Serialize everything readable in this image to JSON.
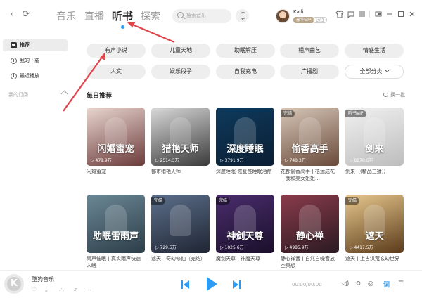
{
  "nav": {
    "back_glyph": "‹",
    "refresh_glyph": "⟳"
  },
  "main_tabs": [
    {
      "label": "音乐"
    },
    {
      "label": "直播"
    },
    {
      "label": "听书"
    },
    {
      "label": "探索"
    }
  ],
  "search": {
    "placeholder": "搜索音乐"
  },
  "user": {
    "name": "Kaili",
    "vip": "豪华VIP",
    "level": "LV.3"
  },
  "sidebar": {
    "items": [
      {
        "label": "推荐"
      },
      {
        "label": "我的下载"
      },
      {
        "label": "最近播放"
      }
    ],
    "section_label": "我的订阅"
  },
  "categories": [
    {
      "label": "有声小说"
    },
    {
      "label": "儿童天地"
    },
    {
      "label": "助眠解压"
    },
    {
      "label": "相声曲艺"
    },
    {
      "label": "情感生活"
    },
    {
      "label": "人文"
    },
    {
      "label": "娱乐段子"
    },
    {
      "label": "自我充电"
    },
    {
      "label": "广播剧"
    },
    {
      "label": "全部分类"
    }
  ],
  "section": {
    "title": "每日推荐",
    "refresh_label": "换一批"
  },
  "cards": [
    {
      "name": "闪婚蜜宠",
      "plays": "479.9万",
      "cover_title": "闪婚蜜宠",
      "tag": "",
      "color_a": "#e9d6cf",
      "color_b": "#6b3b3b"
    },
    {
      "name": "都市猎艳天师",
      "plays": "2514.3万",
      "cover_title": "猎艳天师",
      "tag": "",
      "color_a": "#d9d9d9",
      "color_b": "#3a3a3a"
    },
    {
      "name": "深度睡眠-恢复性睡眠治疗",
      "plays": "3791.9万",
      "cover_title": "深度睡眠",
      "tag": "",
      "color_a": "#0e3a5c",
      "color_b": "#0b1e33"
    },
    {
      "name": "花都偷香高手丨梧运成花丨我和美女姐姐…",
      "plays": "748.3万",
      "cover_title": "偷香高手",
      "tag": "完结",
      "color_a": "#d7c7b8",
      "color_b": "#6a4a3a"
    },
    {
      "name": "剑来（(精品三播)）",
      "plays": "8870.6万",
      "cover_title": "剑来",
      "tag": "听书VIP",
      "color_a": "#f1f1f1",
      "color_b": "#bdbdbd"
    },
    {
      "name": "雨声催眠丨真实雨声快速入眠",
      "plays": "",
      "cover_title": "助眠雷雨声",
      "tag": "",
      "color_a": "#6b8795",
      "color_b": "#2c3e48"
    },
    {
      "name": "遮天—奇幻修仙（完结）",
      "plays": "729.5万",
      "cover_title": "",
      "tag": "完结",
      "color_a": "#5c6f8a",
      "color_b": "#1f2533"
    },
    {
      "name": "魔剑天尊丨神魔天尊",
      "plays": "1025.6万",
      "cover_title": "神剑天尊",
      "tag": "完结",
      "color_a": "#4a2d6d",
      "color_b": "#1a0f2a"
    },
    {
      "name": "静心禅音丨自然白噪音放空冥想",
      "plays": "4985.9万",
      "cover_title": "静心禅",
      "tag": "",
      "color_a": "#8b3b4b",
      "color_b": "#2a1a22"
    },
    {
      "name": "遮天丨上古洪荒玄幻世界",
      "plays": "4417.5万",
      "cover_title": "遮天",
      "tag": "完结",
      "color_a": "#e8c98e",
      "color_b": "#5a3a1a"
    }
  ],
  "player": {
    "name": "酷狗音乐",
    "logo_letter": "K",
    "time": "00:00/00:00",
    "lyric_label": "词"
  },
  "colors": {
    "accent": "#2b9bf4",
    "annotation": "#e0444a"
  }
}
